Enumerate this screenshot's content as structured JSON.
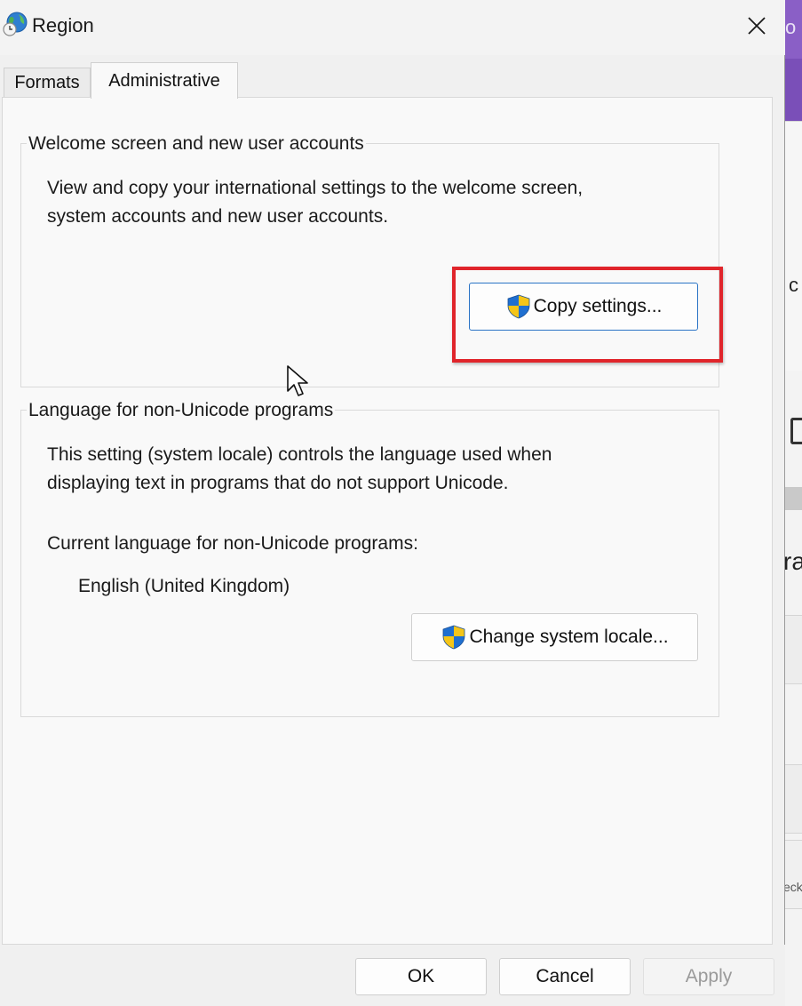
{
  "window": {
    "title": "Region",
    "close_icon": "close-icon"
  },
  "tabs": [
    {
      "label": "Formats",
      "selected": false
    },
    {
      "label": "Administrative",
      "selected": true
    }
  ],
  "welcome_group": {
    "legend": "Welcome screen and new user accounts",
    "description_line1": "View and copy your international settings to the welcome screen,",
    "description_line2": "system accounts and new user accounts.",
    "copy_button_label": "Copy settings...",
    "copy_button_icon": "uac-shield-icon"
  },
  "locale_group": {
    "legend": "Language for non-Unicode programs",
    "description_line1": "This setting (system locale) controls the language used when",
    "description_line2": "displaying text in programs that do not support Unicode.",
    "current_label": "Current language for non-Unicode programs:",
    "current_value": "English (United Kingdom)",
    "change_button_label": "Change system locale...",
    "change_button_icon": "uac-shield-icon"
  },
  "footer": {
    "ok_label": "OK",
    "cancel_label": "Cancel",
    "apply_label": "Apply",
    "apply_enabled": false
  },
  "annotation": {
    "highlight_color": "#e0252b",
    "highlight_target": "copy-settings-button"
  },
  "background_window": {
    "snippet_1": "o",
    "snippet_2": "c",
    "snippet_3": "ra",
    "snippet_4": "eck",
    "accent_color": "#7a4fb8"
  }
}
